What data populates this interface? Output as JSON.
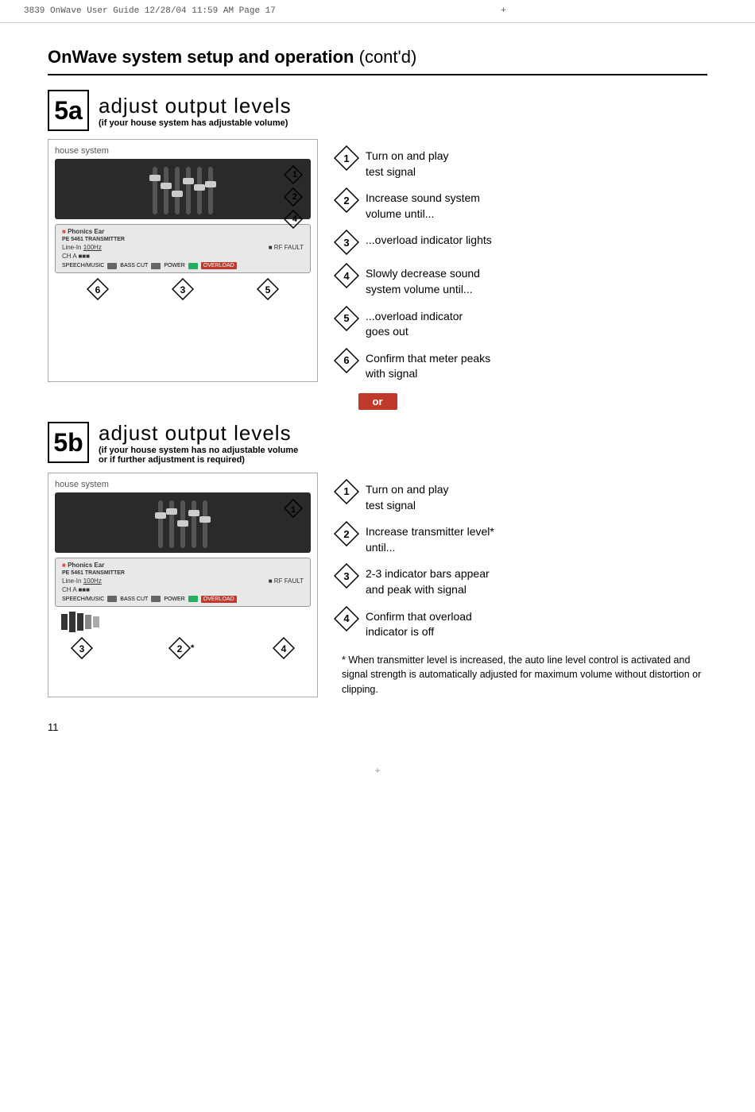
{
  "file_header": {
    "left": "3839 OnWave User Guide   12/28/04   11:59 AM   Page 17",
    "crosshair_top": "+"
  },
  "page_title": {
    "bold_part": "OnWave system setup and operation",
    "normal_part": " (cont'd)"
  },
  "section5a": {
    "label": "5a",
    "title_main": "adjust output levels",
    "title_sub": "(if your house system has adjustable volume)",
    "diagram_label": "house system",
    "steps": [
      {
        "num": "1",
        "text": "Turn on and play\ntest signal"
      },
      {
        "num": "2",
        "text": "Increase sound system\nvolume until..."
      },
      {
        "num": "3",
        "text": "...overload indicator lights"
      },
      {
        "num": "4",
        "text": "Slowly decrease sound\nsystem volume until..."
      },
      {
        "num": "5",
        "text": "...overload indicator\ngoes out"
      },
      {
        "num": "6",
        "text": "Confirm that meter peaks\nwith signal"
      }
    ],
    "diagram_nums": [
      "6",
      "3",
      "5"
    ]
  },
  "or_label": "or",
  "section5b": {
    "label": "5b",
    "title_main": "adjust output levels",
    "title_sub_line1": "(if your house system has",
    "title_sub_bold": "no",
    "title_sub_line2": "adjustable volume",
    "title_sub_line3": "or if further adjustment is required)",
    "diagram_label": "house system",
    "steps": [
      {
        "num": "1",
        "text": "Turn on and play\ntest signal"
      },
      {
        "num": "2",
        "text": "Increase transmitter level*\nuntil..."
      },
      {
        "num": "3",
        "text": "2-3 indicator bars appear\nand peak with signal"
      },
      {
        "num": "4",
        "text": "Confirm that overload\nindicator is off"
      }
    ],
    "diagram_nums": [
      "3",
      "4"
    ],
    "footnote": "* When transmitter level is increased, the auto line level control is activated and signal strength is automatically adjusted for maximum volume without distortion or clipping."
  },
  "page_number": "11"
}
